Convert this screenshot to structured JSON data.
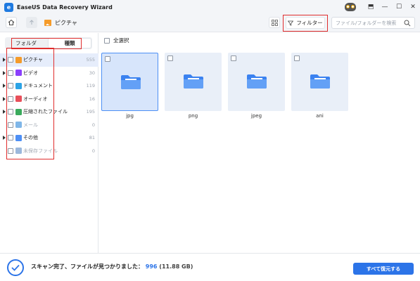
{
  "app": {
    "title": "EaseUS Data Recovery Wizard",
    "accent": "#2c74e8",
    "highlight": "#e02d2d"
  },
  "window": {
    "controls": [
      "⬒",
      "—",
      "☐",
      "✕"
    ]
  },
  "toolbar": {
    "breadcrumb": "ピクチャ",
    "filter_label": "フィルター",
    "search_placeholder": "ファイル/フォルダーを検索"
  },
  "sidebar": {
    "tabs": [
      {
        "label": "フォルダ",
        "active": false
      },
      {
        "label": "種類",
        "active": true
      }
    ],
    "categories": [
      {
        "label": "ピクチャ",
        "count": "555",
        "icon": "image-icon",
        "color": "#f59b2a",
        "expandable": true,
        "selected": true,
        "dim": false
      },
      {
        "label": "ビデオ",
        "count": "30",
        "icon": "video-icon",
        "color": "#8a3ffc",
        "expandable": true,
        "selected": false,
        "dim": false
      },
      {
        "label": "ドキュメント",
        "count": "119",
        "icon": "document-icon",
        "color": "#2ba3e6",
        "expandable": true,
        "selected": false,
        "dim": false
      },
      {
        "label": "オーディオ",
        "count": "16",
        "icon": "audio-icon",
        "color": "#e84f5a",
        "expandable": true,
        "selected": false,
        "dim": false
      },
      {
        "label": "圧縮されたファイル",
        "count": "195",
        "icon": "archive-icon",
        "color": "#3aaa5c",
        "expandable": true,
        "selected": false,
        "dim": false
      },
      {
        "label": "メール",
        "count": "0",
        "icon": "mail-icon",
        "color": "#7fb6e8",
        "expandable": false,
        "selected": false,
        "dim": true
      },
      {
        "label": "その他",
        "count": "81",
        "icon": "folder-icon",
        "color": "#4d8ff5",
        "expandable": true,
        "selected": false,
        "dim": false
      },
      {
        "label": "未保存ファイル",
        "count": "0",
        "icon": "unsaved-file-icon",
        "color": "#9bb8dc",
        "expandable": false,
        "selected": false,
        "dim": true
      }
    ]
  },
  "main": {
    "select_all_label": "全選択",
    "folders": [
      {
        "name": "jpg",
        "selected": true
      },
      {
        "name": "png",
        "selected": false
      },
      {
        "name": "jpeg",
        "selected": false
      },
      {
        "name": "ani",
        "selected": false
      }
    ]
  },
  "footer": {
    "status_text": "スキャン完了、ファイルが見つかりました：",
    "count": "996",
    "size": "(11.88 GB)",
    "recover_label": "すべて復元する"
  }
}
